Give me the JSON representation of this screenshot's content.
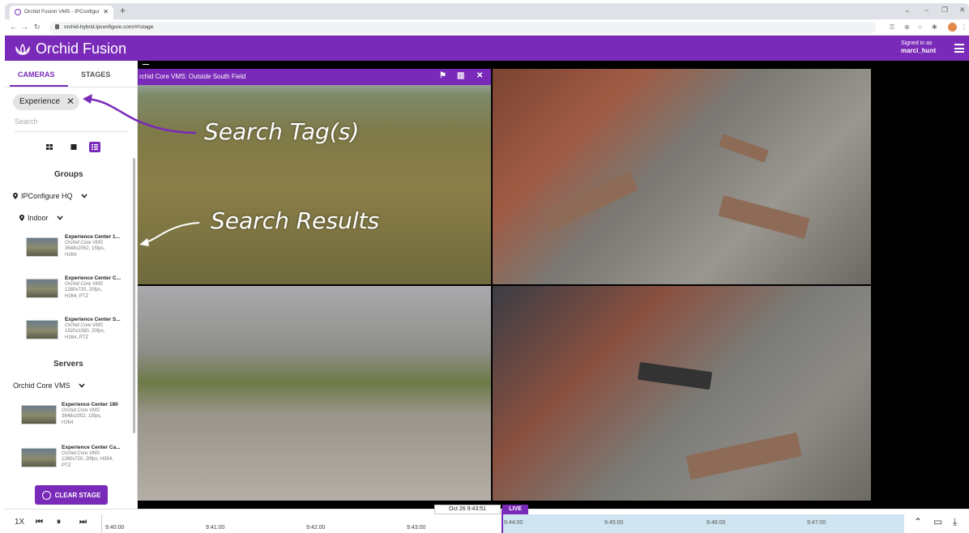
{
  "browser": {
    "tab_title": "Orchid Fusion VMS - IPConfigur",
    "url": "orchid-hybrid.ipconfigure.com/#!/stage"
  },
  "header": {
    "app_name": "Orchid Fusion",
    "signed_in_label": "Signed in as",
    "username": "marci_hunt"
  },
  "sidebar": {
    "tabs": [
      "CAMERAS",
      "STAGES"
    ],
    "tag_chip": "Experience",
    "search_placeholder": "Search",
    "groups_heading": "Groups",
    "group_root": "IPConfigure HQ",
    "group_sub": "Indoor",
    "group_cameras": [
      {
        "title": "Experience Center 1...",
        "server": "Orchid Core VMS",
        "spec1": "3648x2052, 15fps,",
        "spec2": "H264"
      },
      {
        "title": "Experience Center C...",
        "server": "Orchid Core VMS",
        "spec1": "1280x720, 20fps,",
        "spec2": "H264, PTZ"
      },
      {
        "title": "Experience Center S...",
        "server": "Orchid Core VMS",
        "spec1": "1920x1080, 20fps,",
        "spec2": "H264, PTZ"
      }
    ],
    "servers_heading": "Servers",
    "server_name": "Orchid Core VMS",
    "server_cameras": [
      {
        "title": "Experience Center 180",
        "server": "Orchid Core VMS",
        "spec1": "3648x2052, 15fps,",
        "spec2": "H264"
      },
      {
        "title": "Experience Center Ca...",
        "server": "Orchid Core VMS",
        "spec1": "1280x720, 20fps, H264,",
        "spec2": "PTZ"
      }
    ],
    "clear_stage": "CLEAR STAGE"
  },
  "stage": {
    "camera_title": "rchid Core VMS: Outside South Field"
  },
  "timeline": {
    "speed": "1X",
    "current_time": "Oct 26 9:43:51",
    "live": "LIVE",
    "past_labels": [
      "9:40:00",
      "9:41:00",
      "9:42:00",
      "9:43:00"
    ],
    "future_labels": [
      "9:44:00",
      "9:45:00",
      "9:46:00",
      "9:47:00"
    ]
  },
  "annotations": {
    "search_tags": "Search Tag(s)",
    "search_results": "Search Results"
  },
  "colors": {
    "brand_purple": "#7a2ab8",
    "recording_red": "#e83a3a",
    "future_blue": "#cfe6f2"
  }
}
